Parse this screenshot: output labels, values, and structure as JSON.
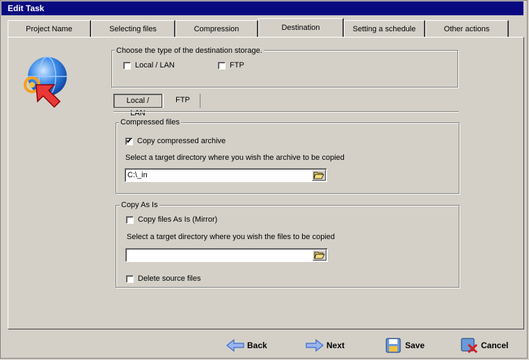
{
  "window": {
    "title": "Edit Task"
  },
  "tabs": [
    {
      "label": "Project Name"
    },
    {
      "label": "Selecting files"
    },
    {
      "label": "Compression"
    },
    {
      "label": "Destination"
    },
    {
      "label": "Setting a schedule"
    },
    {
      "label": "Other actions"
    }
  ],
  "active_tab": "Destination",
  "storage_type": {
    "legend": "Choose the type of the destination storage.",
    "local_lan": {
      "label": "Local / LAN",
      "checked": false
    },
    "ftp": {
      "label": "FTP",
      "checked": false
    }
  },
  "subtabs": [
    {
      "label": "Local / LAN"
    },
    {
      "label": "FTP"
    }
  ],
  "compressed_files": {
    "legend": "Compressed files",
    "copy_archive": {
      "label": "Copy compressed archive",
      "checked": true
    },
    "instruction": "Select a target directory where you wish the archive to be copied",
    "path_value": "C:\\_in"
  },
  "copy_as_is": {
    "legend": "Copy As Is",
    "copy_files": {
      "label": "Copy files As Is (Mirror)",
      "checked": false
    },
    "instruction": "Select a target directory where you wish the files to be copied",
    "path_value": "",
    "delete_source": {
      "label": "Delete source files",
      "checked": false
    }
  },
  "buttons": {
    "back": "Back",
    "next": "Next",
    "save": "Save",
    "cancel": "Cancel"
  },
  "check_mark": "✔",
  "colors": {
    "titlebar": "#0a0a80",
    "face": "#d4d0c8",
    "arrow_blue": "#3a6cc8",
    "cancel_red": "#d02020"
  }
}
